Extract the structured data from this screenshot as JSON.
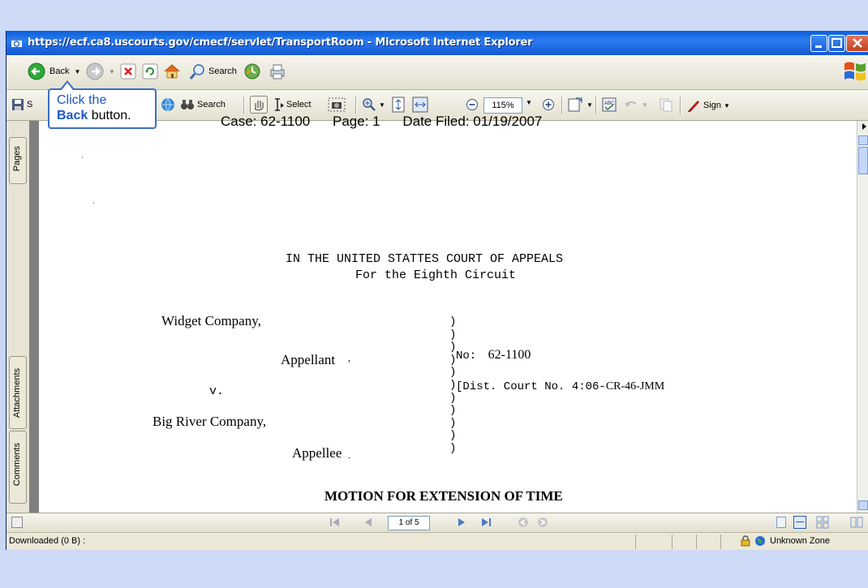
{
  "window": {
    "title": "https://ecf.ca8.uscourts.gov/cmecf/servlet/TransportRoom - Microsoft Internet Explorer"
  },
  "ie_toolbar": {
    "back_label": "Back",
    "search_label": "Search"
  },
  "adobe_toolbar": {
    "save_label": "S",
    "search_label": "Search",
    "select_label": "Select",
    "zoom_value": "115%",
    "sign_label": "Sign"
  },
  "callout": {
    "line1": "Click the",
    "bold": "Back",
    "rest": " button."
  },
  "sidenav": {
    "pages": "Pages",
    "attachments": "Attachments",
    "comments": "Comments"
  },
  "document": {
    "case": "Case: 62-1100",
    "page": "Page: 1",
    "date_filed": "Date Filed: 01/19/2007",
    "court_line1": "IN THE UNITED STATTES COURT OF APPEALS",
    "court_line2": "For the Eighth Circuit",
    "appellant_name": "Widget Company,",
    "appellant_role": "Appellant",
    "versus": "v.",
    "appellee_name": "Big River Company,",
    "appellee_role": "Appellee",
    "no_prefix": "No:",
    "no_value": "62-1100",
    "dist_prefix": "[Dist. Court No. 4:06-",
    "dist_value": "CR-46-JMM",
    "motion_title": "MOTION FOR EXTENSION OF TIME"
  },
  "pagebar": {
    "page_indicator": "1 of 5"
  },
  "status": {
    "downloaded": "Downloaded  (0 B) :",
    "zone": "Unknown Zone"
  }
}
